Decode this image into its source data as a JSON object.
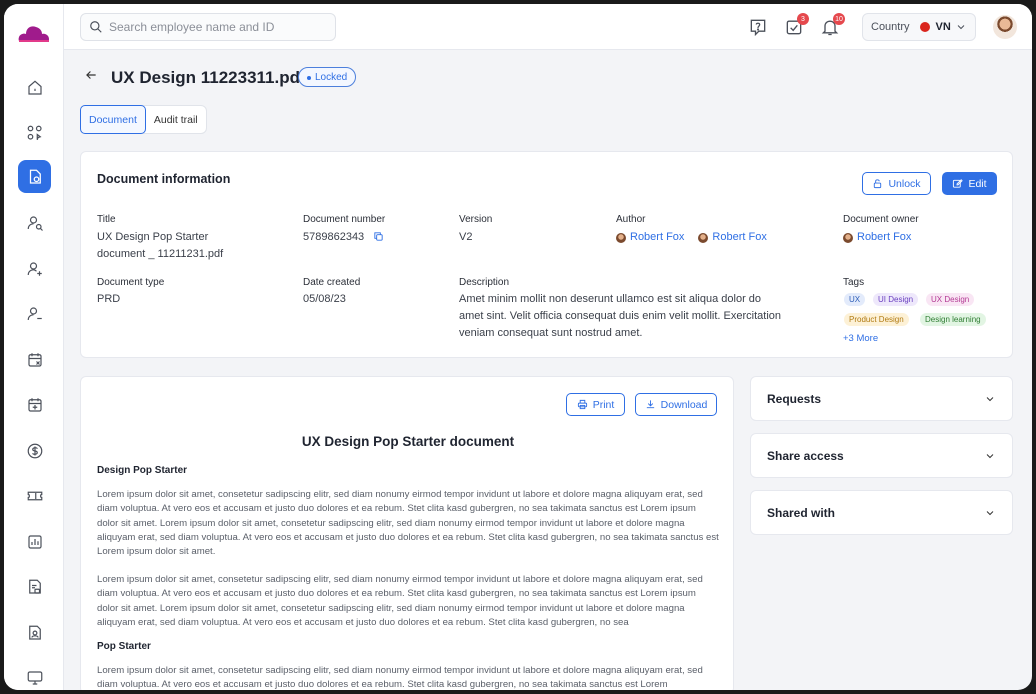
{
  "search": {
    "placeholder": "Search employee name and ID"
  },
  "topbar": {
    "badge_tasks": "3",
    "badge_notifications": "10",
    "country_label": "Country",
    "country_code": "VN"
  },
  "header": {
    "title": "UX Design 11223311.pdf",
    "status": "Locked",
    "tabs": [
      "Document",
      "Audit trail"
    ]
  },
  "info": {
    "heading": "Document information",
    "unlock_label": "Unlock",
    "edit_label": "Edit",
    "fields": {
      "title_label": "Title",
      "title_value": "UX Design Pop Starter document _ 11211231.pdf",
      "docnum_label": "Document number",
      "docnum_value": "5789862343",
      "version_label": "Version",
      "version_value": "V2",
      "author_label": "Author",
      "authors": [
        "Robert Fox",
        "Robert Fox"
      ],
      "owner_label": "Document owner",
      "owner_value": "Robert Fox",
      "type_label": "Document type",
      "type_value": "PRD",
      "date_label": "Date created",
      "date_value": "05/08/23",
      "desc_label": "Description",
      "desc_value": "Amet minim mollit non deserunt ullamco est sit aliqua dolor do amet sint. Velit officia consequat duis enim velit mollit. Exercitation veniam consequat sunt nostrud amet.",
      "tags_label": "Tags",
      "tags": [
        "UX",
        "UI Design",
        "UX Design",
        "Product Design",
        "Design learning"
      ],
      "more_tags": "+3 More"
    }
  },
  "doc": {
    "print_label": "Print",
    "download_label": "Download",
    "title": "UX Design Pop Starter document",
    "section1": "Design Pop Starter",
    "para1": "Lorem ipsum dolor sit amet, consetetur sadipscing elitr, sed diam nonumy eirmod tempor invidunt ut labore et dolore magna aliquyam erat, sed diam voluptua. At vero eos et accusam et justo duo dolores et ea rebum. Stet clita kasd gubergren, no sea takimata sanctus est Lorem ipsum dolor sit amet. Lorem ipsum dolor sit amet, consetetur sadipscing elitr, sed diam nonumy eirmod tempor invidunt ut labore et dolore magna aliquyam erat, sed diam voluptua. At vero eos et accusam et justo duo dolores et ea rebum. Stet clita kasd gubergren, no sea takimata sanctus est Lorem ipsum dolor sit amet.",
    "para2": "Lorem ipsum dolor sit amet, consetetur sadipscing elitr, sed diam nonumy eirmod tempor invidunt ut labore et dolore magna aliquyam erat, sed diam voluptua. At vero eos et accusam et justo duo dolores et ea rebum. Stet clita kasd gubergren, no sea takimata sanctus est Lorem ipsum dolor sit amet. Lorem ipsum dolor sit amet, consetetur sadipscing elitr, sed diam nonumy eirmod tempor invidunt ut labore et dolore magna aliquyam erat, sed diam voluptua. At vero eos et accusam et justo duo dolores et ea rebum. Stet clita kasd gubergren, no sea",
    "section2": "Pop Starter",
    "para3": "Lorem ipsum dolor sit amet, consetetur sadipscing elitr, sed diam nonumy eirmod tempor invidunt ut labore et dolore magna aliquyam erat, sed diam voluptua. At vero eos et accusam et justo duo dolores et ea rebum. Stet clita kasd gubergren, no sea takimata sanctus est Lorem"
  },
  "panels": [
    "Requests",
    "Share access",
    "Shared with"
  ],
  "colors": {
    "accent": "#2f6fe4",
    "logo": "#a01b8c",
    "badge": "#e5484d"
  }
}
